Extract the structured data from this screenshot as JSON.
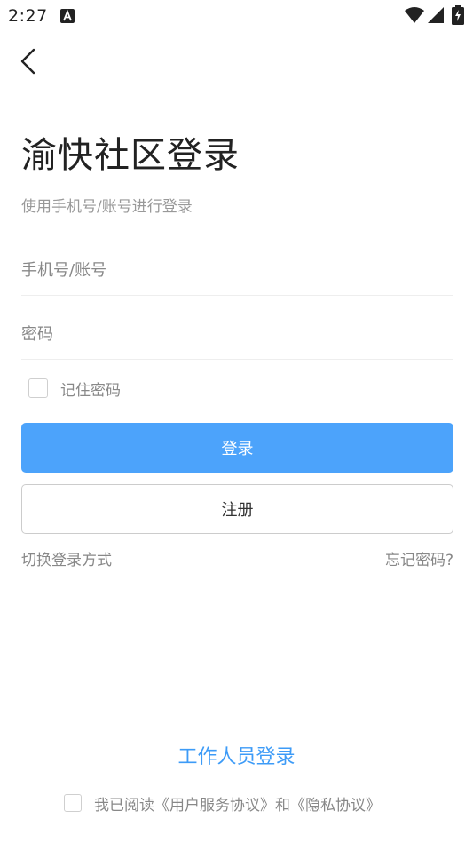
{
  "status_bar": {
    "time": "2:27",
    "icons": [
      "a-notification-icon",
      "wifi-icon",
      "signal-icon",
      "battery-charging-icon"
    ]
  },
  "header": {
    "back_icon": "chevron-left-icon"
  },
  "login": {
    "title": "渝快社区登录",
    "subtitle": "使用手机号/账号进行登录",
    "account_placeholder": "手机号/账号",
    "account_value": "",
    "password_placeholder": "密码",
    "password_value": "",
    "remember_label": "记住密码",
    "remember_checked": false,
    "login_button": "登录",
    "register_button": "注册",
    "switch_method": "切换登录方式",
    "forgot_password": "忘记密码?"
  },
  "footer": {
    "staff_login": "工作人员登录",
    "agreement_text": "我已阅读《用户服务协议》和《隐私协议》",
    "agreement_checked": false
  },
  "colors": {
    "primary": "#4ca3fb",
    "link": "#3d9bf7",
    "muted_text": "#888888",
    "title_text": "#222222"
  }
}
